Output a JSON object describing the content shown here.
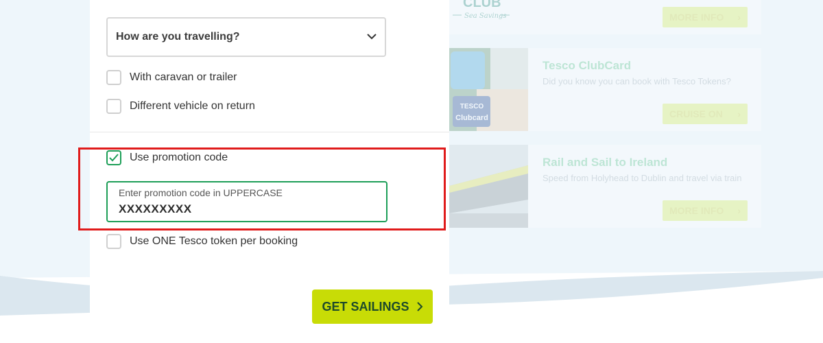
{
  "journey": {
    "select_label": "How are you travelling?"
  },
  "options": {
    "caravan_label": "With caravan or trailer",
    "different_vehicle_label": "Different vehicle on return",
    "promo_label": "Use promotion code",
    "promo_checked": true,
    "tesco_token_label": "Use ONE Tesco token per booking"
  },
  "promo_code": {
    "placeholder": "Enter promotion code in UPPERCASE",
    "value": "XXXXXXXXX"
  },
  "cta": {
    "label": "GET SAILINGS"
  },
  "promos": [
    {
      "title": "",
      "desc": "",
      "button": "MORE INFO",
      "logo_text": "CLUB",
      "logo_sub": "Sea Savings"
    },
    {
      "title": "Tesco ClubCard",
      "desc": "Did you know you can book with Tesco Tokens?",
      "button": "CRUISE ON",
      "card_brand": "TESCO",
      "card_name": "Clubcard"
    },
    {
      "title": "Rail and Sail to Ireland",
      "desc": "Speed from Holyhead to Dublin and travel via train",
      "button": "MORE INFO"
    }
  ],
  "colors": {
    "accent_green": "#1c9e57",
    "cta_lime": "#c8dc06",
    "highlight_red": "#e01b1b"
  }
}
